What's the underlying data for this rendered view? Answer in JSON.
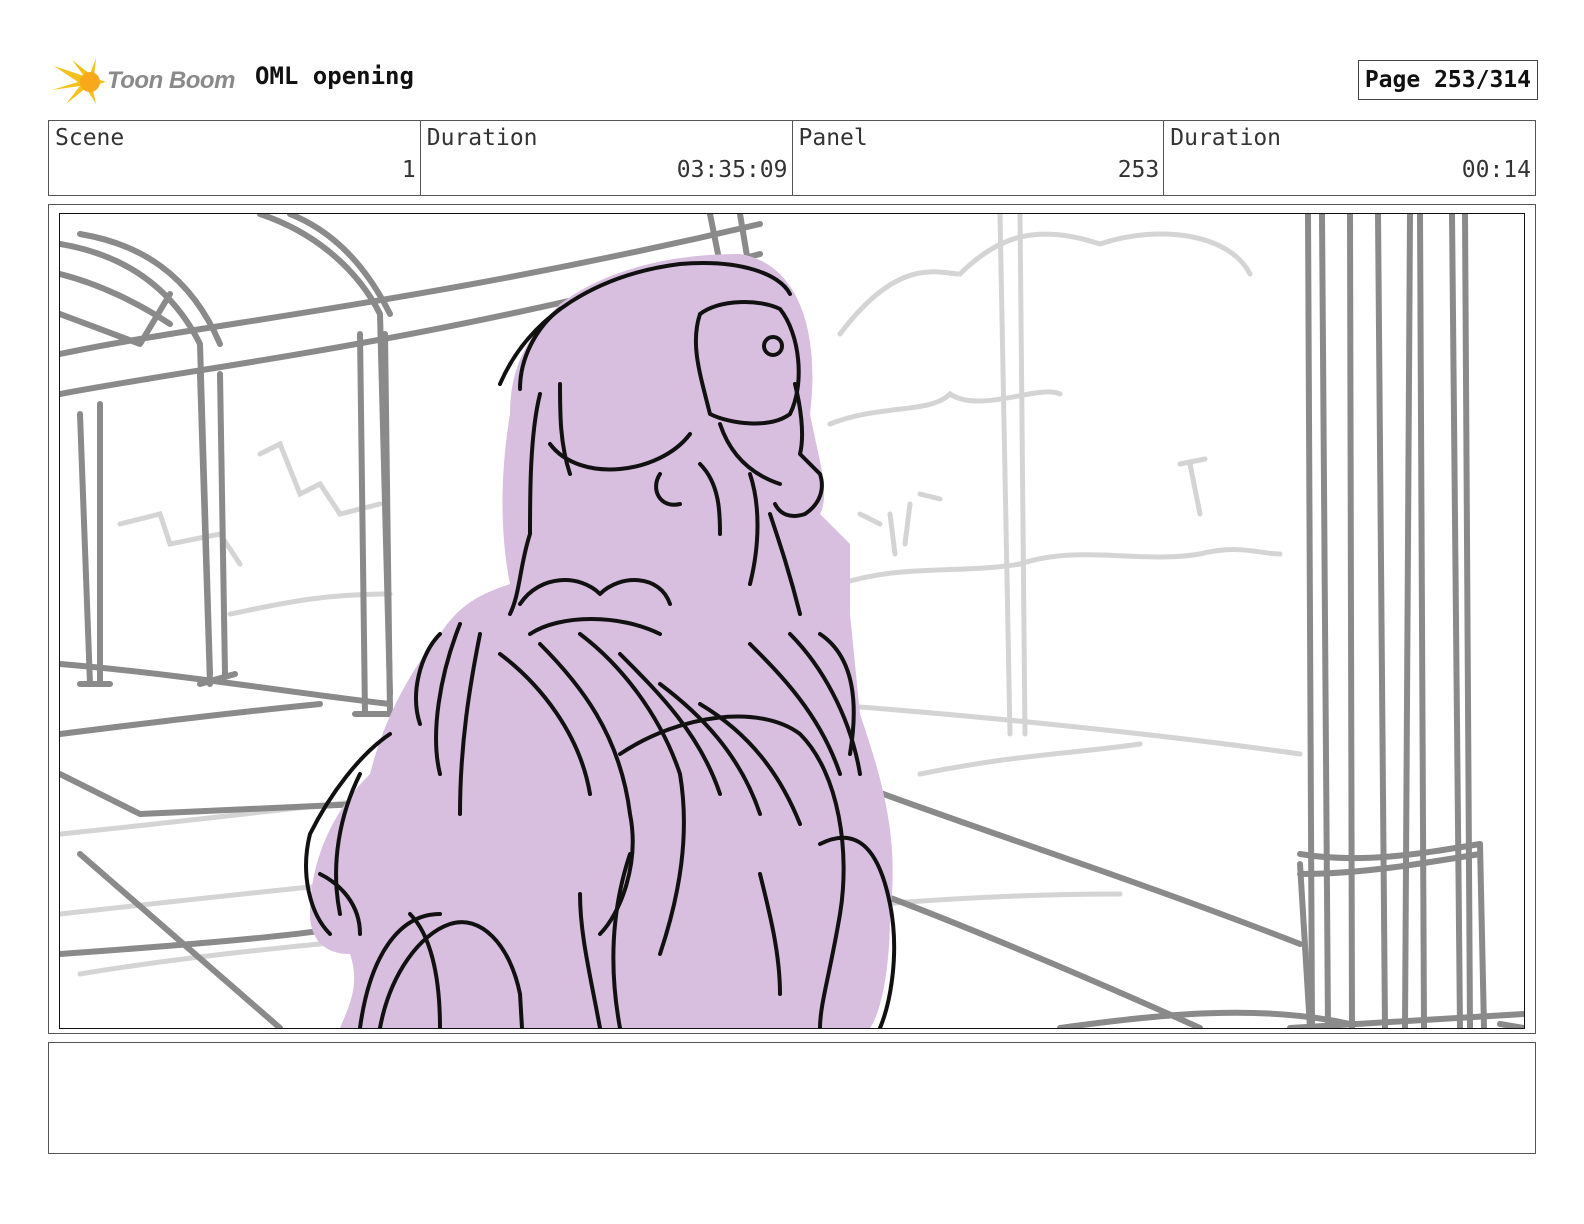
{
  "header": {
    "logo_text": "Toon Boom",
    "project_title": "OML opening",
    "page_label": "Page 253/314"
  },
  "info": {
    "scene_label": "Scene",
    "scene_value": "1",
    "scene_duration_label": "Duration",
    "scene_duration_value": "03:35:09",
    "panel_label": "Panel",
    "panel_value": "253",
    "panel_duration_label": "Duration",
    "panel_duration_value": "00:14"
  },
  "panel": {
    "background_line_color": "#8a8a8a",
    "faint_line_color": "#d4d4d4",
    "character_fill_color": "#d8bfdf",
    "ink_color": "#111111"
  },
  "notes": {
    "text": ""
  }
}
